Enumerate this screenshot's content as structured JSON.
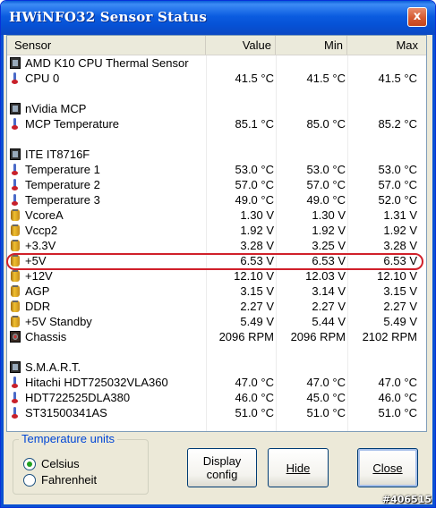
{
  "window": {
    "title": "HWiNFO32 Sensor Status",
    "close_label": "x"
  },
  "columns": {
    "sensor": "Sensor",
    "value": "Value",
    "min": "Min",
    "max": "Max"
  },
  "rows": [
    {
      "type": "group",
      "icon": "chip-icon",
      "name": "AMD K10 CPU Thermal Sensor"
    },
    {
      "type": "item",
      "icon": "thermometer-icon",
      "name": "CPU 0",
      "value": "41.5 °C",
      "min": "41.5 °C",
      "max": "41.5 °C"
    },
    {
      "type": "spacer"
    },
    {
      "type": "group",
      "icon": "chip-icon",
      "name": "nVidia MCP"
    },
    {
      "type": "item",
      "icon": "thermometer-icon",
      "name": "MCP Temperature",
      "value": "85.1 °C",
      "min": "85.0 °C",
      "max": "85.2 °C"
    },
    {
      "type": "spacer"
    },
    {
      "type": "group",
      "icon": "chip-icon",
      "name": "ITE IT8716F"
    },
    {
      "type": "item",
      "icon": "thermometer-icon",
      "name": "Temperature 1",
      "value": "53.0 °C",
      "min": "53.0 °C",
      "max": "53.0 °C"
    },
    {
      "type": "item",
      "icon": "thermometer-icon",
      "name": "Temperature 2",
      "value": "57.0 °C",
      "min": "57.0 °C",
      "max": "57.0 °C"
    },
    {
      "type": "item",
      "icon": "thermometer-icon",
      "name": "Temperature 3",
      "value": "49.0 °C",
      "min": "49.0 °C",
      "max": "52.0 °C"
    },
    {
      "type": "item",
      "icon": "voltage-icon",
      "name": "VcoreA",
      "value": "1.30 V",
      "min": "1.30 V",
      "max": "1.31 V"
    },
    {
      "type": "item",
      "icon": "voltage-icon",
      "name": "Vccp2",
      "value": "1.92 V",
      "min": "1.92 V",
      "max": "1.92 V"
    },
    {
      "type": "item",
      "icon": "voltage-icon",
      "name": "+3.3V",
      "value": "3.28 V",
      "min": "3.25 V",
      "max": "3.28 V"
    },
    {
      "type": "item",
      "icon": "voltage-icon",
      "name": "+5V",
      "value": "6.53 V",
      "min": "6.53 V",
      "max": "6.53 V",
      "highlighted": true
    },
    {
      "type": "item",
      "icon": "voltage-icon",
      "name": "+12V",
      "value": "12.10 V",
      "min": "12.03 V",
      "max": "12.10 V"
    },
    {
      "type": "item",
      "icon": "voltage-icon",
      "name": "AGP",
      "value": "3.15 V",
      "min": "3.14 V",
      "max": "3.15 V"
    },
    {
      "type": "item",
      "icon": "voltage-icon",
      "name": "DDR",
      "value": "2.27 V",
      "min": "2.27 V",
      "max": "2.27 V"
    },
    {
      "type": "item",
      "icon": "voltage-icon",
      "name": "+5V Standby",
      "value": "5.49 V",
      "min": "5.44 V",
      "max": "5.49 V"
    },
    {
      "type": "item",
      "icon": "fan-icon",
      "name": "Chassis",
      "value": "2096 RPM",
      "min": "2096 RPM",
      "max": "2102 RPM"
    },
    {
      "type": "spacer"
    },
    {
      "type": "group",
      "icon": "chip-icon",
      "name": "S.M.A.R.T."
    },
    {
      "type": "item",
      "icon": "thermometer-icon",
      "name": "Hitachi HDT725032VLA360",
      "value": "47.0 °C",
      "min": "47.0 °C",
      "max": "47.0 °C"
    },
    {
      "type": "item",
      "icon": "thermometer-icon",
      "name": "HDT722525DLA380",
      "value": "46.0 °C",
      "min": "45.0 °C",
      "max": "46.0 °C"
    },
    {
      "type": "item",
      "icon": "thermometer-icon",
      "name": "ST31500341AS",
      "value": "51.0 °C",
      "min": "51.0 °C",
      "max": "51.0 °C"
    }
  ],
  "units": {
    "title": "Temperature units",
    "options": [
      {
        "label": "Celsius",
        "selected": true
      },
      {
        "label": "Fahrenheit",
        "selected": false
      }
    ]
  },
  "buttons": {
    "display_config": "Display config",
    "hide": "Hide",
    "close": "Close"
  },
  "watermark": "#406515",
  "colors": {
    "titlebar": "#0a5fd8",
    "highlight_ring": "#d0202a",
    "group_title": "#0046d5",
    "radio_selected": "#21a121"
  }
}
